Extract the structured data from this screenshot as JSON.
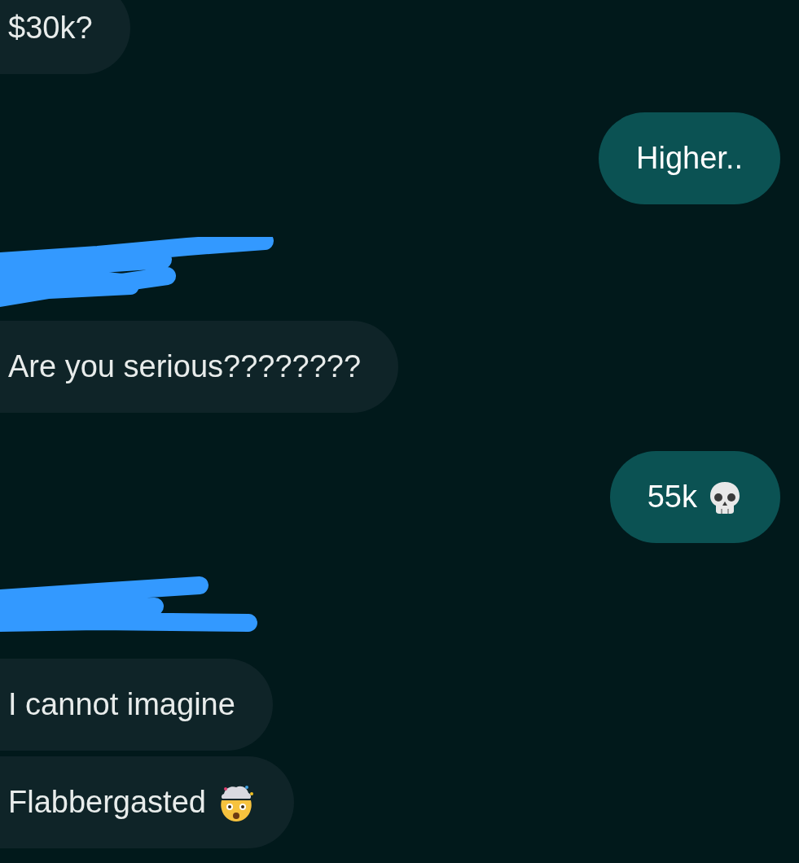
{
  "messages": [
    {
      "kind": "incoming",
      "text": "$30k?"
    },
    {
      "kind": "outgoing",
      "text": "Higher.."
    },
    {
      "kind": "redaction"
    },
    {
      "kind": "incoming",
      "text": "Are you serious????????"
    },
    {
      "kind": "outgoing",
      "text": "55k"
    },
    {
      "kind": "redaction"
    },
    {
      "kind": "incoming",
      "text": "I cannot imagine"
    },
    {
      "kind": "incoming",
      "text": "Flabbergasted"
    }
  ]
}
